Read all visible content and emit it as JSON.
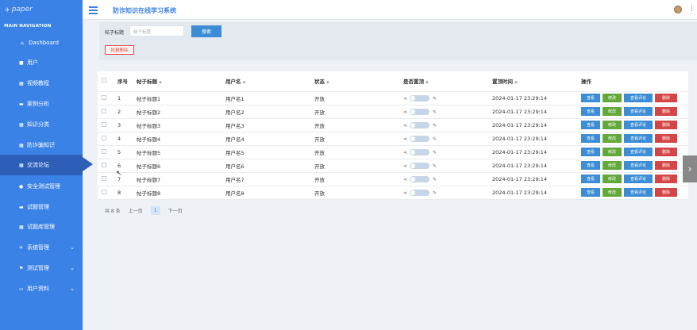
{
  "logo": {
    "text": "paper",
    "icon": "paper-plane-icon"
  },
  "sidebar": {
    "heading": "MAIN NAVIGATION",
    "items": [
      {
        "label": "Dashboard",
        "icon": "home-icon"
      },
      {
        "label": "用户",
        "icon": "folder-icon"
      },
      {
        "label": "视频教程",
        "icon": "grid-icon"
      },
      {
        "label": "案例分析",
        "icon": "comment-icon"
      },
      {
        "label": "知识分类",
        "icon": "grid-icon"
      },
      {
        "label": "防诈骗知识",
        "icon": "grid-icon"
      },
      {
        "label": "交流论坛",
        "icon": "grid-icon",
        "active": true
      },
      {
        "label": "安全测试管理",
        "icon": "user-icon"
      },
      {
        "label": "试题管理",
        "icon": "comment-icon"
      },
      {
        "label": "试题库管理",
        "icon": "grid-icon"
      },
      {
        "label": "系统管理",
        "icon": "paper-plane-icon",
        "expandable": true
      },
      {
        "label": "测试管理",
        "icon": "flag-icon",
        "expandable": true
      },
      {
        "label": "用户资料",
        "icon": "id-card-icon",
        "expandable": true
      }
    ]
  },
  "header": {
    "title": "防诈知识在线学习系统"
  },
  "search": {
    "label": "帖子标题",
    "placeholder": "帖子标题",
    "button": "搜索",
    "batch_delete": "批量删除"
  },
  "table": {
    "columns": [
      "序号",
      "帖子标题",
      "用户名",
      "状态",
      "是否置顶",
      "置顶时间",
      "操作"
    ],
    "rows": [
      {
        "no": "1",
        "title": "帖子标题1",
        "user": "用户名1",
        "status": "开放",
        "time": "2024-01-17 23:29:14"
      },
      {
        "no": "2",
        "title": "帖子标题2",
        "user": "用户名2",
        "status": "开放",
        "time": "2024-01-17 23:29:14"
      },
      {
        "no": "3",
        "title": "帖子标题3",
        "user": "用户名3",
        "status": "开放",
        "time": "2024-01-17 23:29:14"
      },
      {
        "no": "4",
        "title": "帖子标题4",
        "user": "用户名4",
        "status": "开放",
        "time": "2024-01-17 23:29:14"
      },
      {
        "no": "5",
        "title": "帖子标题5",
        "user": "用户名5",
        "status": "开放",
        "time": "2024-01-17 23:29:14"
      },
      {
        "no": "6",
        "title": "帖子标题6",
        "user": "用户名6",
        "status": "开放",
        "time": "2024-01-17 23:29:14"
      },
      {
        "no": "7",
        "title": "帖子标题7",
        "user": "用户名7",
        "status": "开放",
        "time": "2024-01-17 23:29:14"
      },
      {
        "no": "8",
        "title": "帖子标题8",
        "user": "用户名8",
        "status": "开放",
        "time": "2024-01-17 23:29:14"
      }
    ],
    "actions": {
      "view": "查看",
      "edit": "修改",
      "view_comments": "查看评论",
      "delete": "删除"
    }
  },
  "pagination": {
    "total": "共 8 条",
    "prev": "上一页",
    "current": "1",
    "next": "下一页"
  },
  "colors": {
    "sidebar": "#3b82e6",
    "sidebar_active": "#2d5fb8",
    "primary": "#3c8dd6",
    "success": "#62a83a",
    "danger": "#d64545"
  }
}
